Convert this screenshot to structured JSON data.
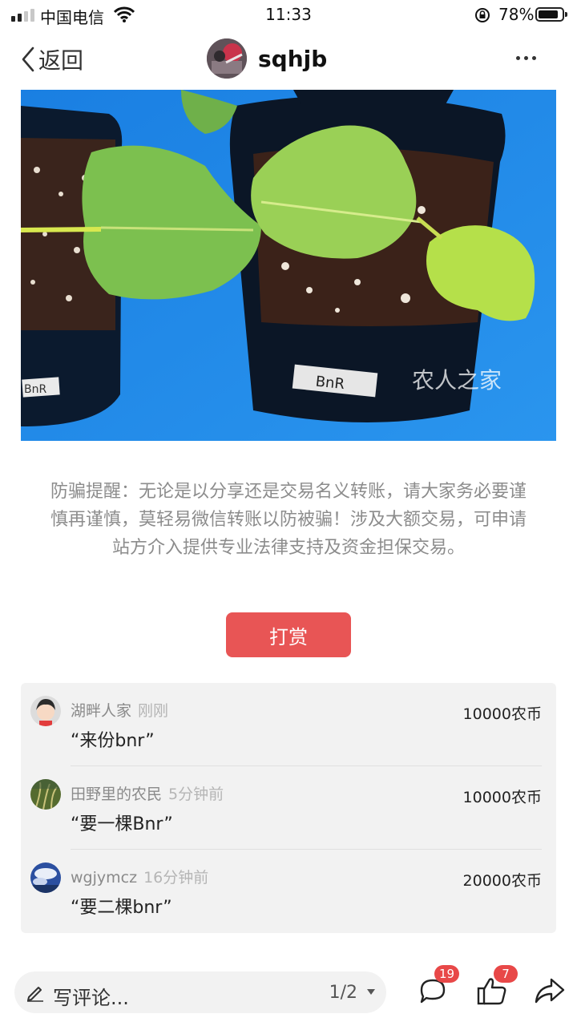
{
  "status_bar": {
    "carrier": "中国电信",
    "time": "11:33",
    "battery_percent": "78%",
    "battery_level": 0.78
  },
  "nav": {
    "back_label": "返回",
    "author_name": "sqhjb"
  },
  "photo": {
    "label_left": "BnR",
    "label_right": "BnR",
    "watermark": "农人之家",
    "icons": [
      "plant-photo"
    ]
  },
  "notice": {
    "text": "防骗提醒：无论是以分享还是交易名义转账，请大家务必要谨慎再谨慎，莫轻易微信转账以防被骗！涉及大额交易，可申请站方介入提供专业法律支持及资金担保交易。"
  },
  "reward_button": {
    "label": "打赏",
    "color": "#e85555"
  },
  "tips": [
    {
      "user": "湖畔人家",
      "time": "刚刚",
      "message": "“来份bnr”",
      "amount": "10000农币"
    },
    {
      "user": "田野里的农民",
      "time": "5分钟前",
      "message": "“要一棵Bnr”",
      "amount": "10000农币"
    },
    {
      "user": "wgjymcz",
      "time": "16分钟前",
      "message": "“要二棵bnr”",
      "amount": "20000农币"
    }
  ],
  "bottom_bar": {
    "comment_placeholder": "写评论...",
    "page_indicator": "1/2",
    "comment_count": "19",
    "like_count": "7",
    "icons": [
      "pencil-icon",
      "comment-icon",
      "thumbs-up-icon",
      "share-icon"
    ],
    "badge_color": "#e84848"
  }
}
